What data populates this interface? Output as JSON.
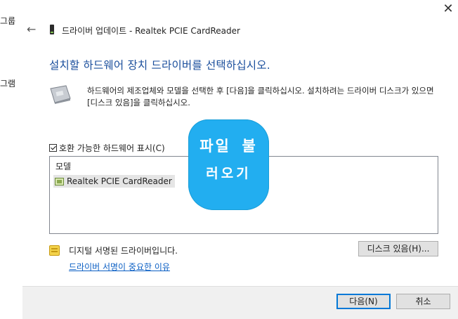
{
  "background_window": {
    "fragments": [
      "그룹",
      "그램"
    ]
  },
  "dialog": {
    "title": "드라이버 업데이트 - Realtek PCIE CardReader",
    "heading": "설치할 하드웨어 장치 드라이버를 선택하십시오.",
    "description": "하드웨어의 제조업체와 모델을 선택한 후 [다음]을 클릭하십시오. 설치하려는 드라이버 디스크가 있으면 [디스크 있음]을 클릭하십시오.",
    "show_compatible_label": "호환 가능한 하드웨어 표시(C)",
    "show_compatible_checked": true,
    "list_header": "모델",
    "models": [
      "Realtek PCIE CardReader"
    ],
    "signature_text": "디지털 서명된 드라이버입니다.",
    "signature_link": "드라이버 서명이 중요한 이유",
    "have_disk_button": "디스크 있음(H)...",
    "next_button": "다음(N)",
    "cancel_button": "취소"
  },
  "overlay_bubble": {
    "line1": "파일 불",
    "line2": "러오기",
    "color": "#22aef0"
  },
  "colors": {
    "heading": "#1a4e9c",
    "link": "#0b5fc4",
    "accent": "#0078d7"
  }
}
